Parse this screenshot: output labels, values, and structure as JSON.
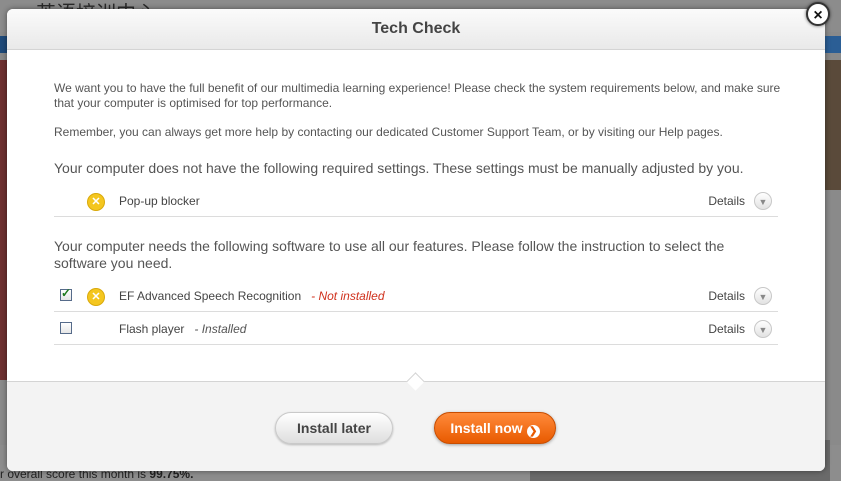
{
  "background": {
    "site_title": "英语培训中心",
    "footer_text_prefix": "r overall score this month is ",
    "footer_score": "99.75%."
  },
  "modal": {
    "title": "Tech Check",
    "close_symbol": "×",
    "intro": "We want you to have the full benefit of our multimedia learning experience! Please check the system requirements below, and make sure that your computer is optimised for top performance.",
    "remember": "Remember, you can always get more help by contacting our dedicated Customer Support Team, or by visiting our Help pages.",
    "required_heading": "Your computer does not have the following required settings. These settings must be manually adjusted by you.",
    "required_items": [
      {
        "label": "Pop-up blocker",
        "details": "Details",
        "icon": "warning-x-icon"
      }
    ],
    "software_heading": "Your computer needs the following software to use all our features. Please follow the instruction to select the software you need.",
    "software_items": [
      {
        "label": "EF Advanced Speech Recognition",
        "status": "- Not installed",
        "details": "Details",
        "checked": true,
        "icon": "warning-x-icon"
      },
      {
        "label": "Flash player",
        "status": "- Installed",
        "details": "Details",
        "checked": false
      }
    ],
    "buttons": {
      "later": "Install later",
      "now": "Install now"
    }
  },
  "colors": {
    "accent_orange": "#e85a00",
    "warning_yellow": "#f4c61f",
    "not_installed_red": "#d0321e"
  }
}
